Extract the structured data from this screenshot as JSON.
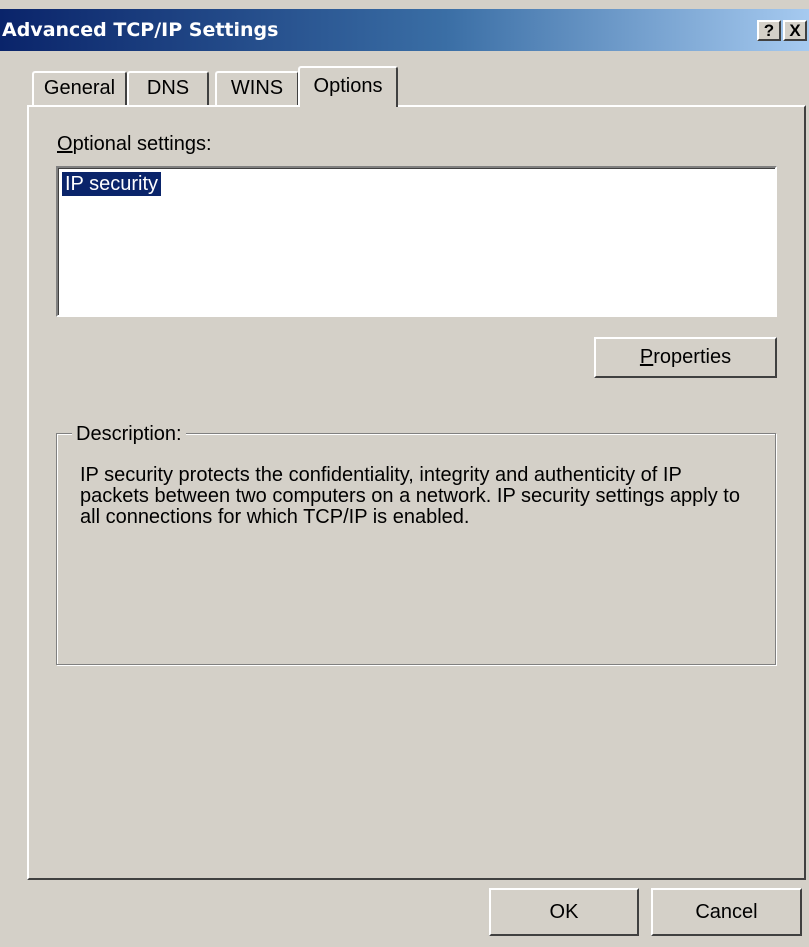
{
  "window": {
    "title": "Advanced TCP/IP Settings",
    "help_label": "?",
    "close_label": "X"
  },
  "tabs": [
    {
      "label": "General",
      "active": false
    },
    {
      "label": "DNS",
      "active": false
    },
    {
      "label": "WINS",
      "active": false
    },
    {
      "label": "Options",
      "active": true
    }
  ],
  "options": {
    "optional_settings_label_accel": "O",
    "optional_settings_label_rest": "ptional settings:",
    "items": [
      {
        "label": "IP security",
        "selected": true
      }
    ],
    "properties_button_accel": "P",
    "properties_button_rest": "roperties",
    "description_label": "Description:",
    "description_text": "IP security protects the confidentiality, integrity and authenticity of IP packets between two computers on a network. IP security settings apply to all connections for which TCP/IP is enabled."
  },
  "footer": {
    "ok_label": "OK",
    "cancel_label": "Cancel"
  },
  "colors": {
    "title_gradient_start": "#0a246a",
    "title_gradient_end": "#a6caf0",
    "face": "#d4d0c8",
    "selection": "#0a246a"
  }
}
